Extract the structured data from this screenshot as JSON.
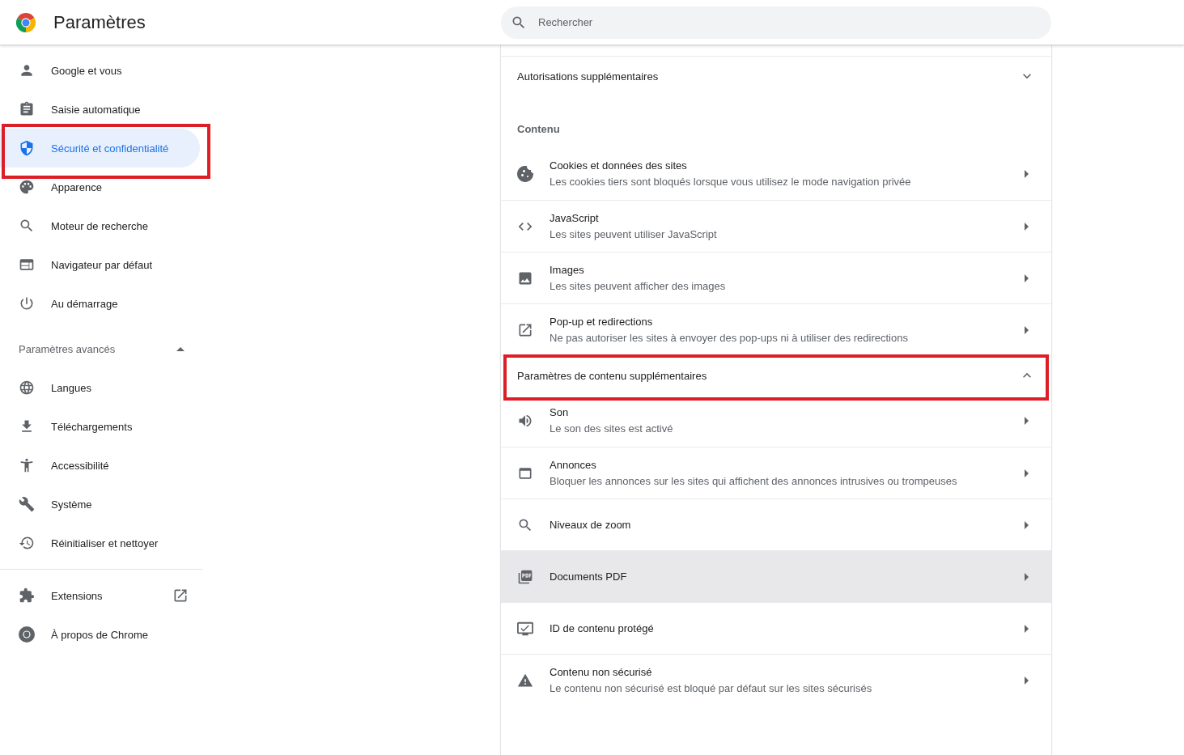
{
  "header": {
    "title": "Paramètres",
    "search": {
      "placeholder": "Rechercher"
    }
  },
  "sidebar": {
    "items": [
      {
        "label": "Google et vous",
        "selected": false,
        "highlighted": false
      },
      {
        "label": "Saisie automatique",
        "selected": false,
        "highlighted": false
      },
      {
        "label": "Sécurité et confidentialité",
        "selected": true,
        "highlighted": true
      },
      {
        "label": "Apparence",
        "selected": false,
        "highlighted": false
      },
      {
        "label": "Moteur de recherche",
        "selected": false,
        "highlighted": false
      },
      {
        "label": "Navigateur par défaut",
        "selected": false,
        "highlighted": false
      },
      {
        "label": "Au démarrage",
        "selected": false,
        "highlighted": false
      }
    ],
    "advanced": {
      "label": "Paramètres avancés",
      "expanded": true,
      "items": [
        {
          "label": "Langues",
          "selected": false
        },
        {
          "label": "Téléchargements",
          "selected": false
        },
        {
          "label": "Accessibilité",
          "selected": false
        },
        {
          "label": "Système",
          "selected": false
        },
        {
          "label": "Réinitialiser et nettoyer",
          "selected": false
        }
      ]
    },
    "links": [
      {
        "label": "Extensions",
        "selected": false,
        "external": true
      },
      {
        "label": "À propos de Chrome",
        "selected": false,
        "external": false
      }
    ]
  },
  "content": {
    "permissions": {
      "label": "Autorisations supplémentaires",
      "expanded": false
    },
    "heading": "Contenu",
    "rows": [
      {
        "title": "Cookies et données des sites",
        "description": "Les cookies tiers sont bloqués lorsque vous utilisez le mode navigation privée",
        "hovered": false
      },
      {
        "title": "JavaScript",
        "description": "Les sites peuvent utiliser JavaScript",
        "hovered": false
      },
      {
        "title": "Images",
        "description": "Les sites peuvent afficher des images",
        "hovered": false
      },
      {
        "title": "Pop-up et redirections",
        "description": "Ne pas autoriser les sites à envoyer des pop-ups ni à utiliser des redirections",
        "hovered": false
      }
    ],
    "more": {
      "label": "Paramètres de contenu supplémentaires",
      "expanded": true,
      "highlighted": true,
      "rows": [
        {
          "title": "Son",
          "description": "Le son des sites est activé",
          "hovered": false
        },
        {
          "title": "Annonces",
          "description": "Bloquer les annonces sur les sites qui affichent des annonces intrusives ou trompeuses",
          "hovered": false
        },
        {
          "title": "Niveaux de zoom",
          "hovered": false
        },
        {
          "title": "Documents PDF",
          "hovered": true
        },
        {
          "title": "ID de contenu protégé",
          "hovered": false
        },
        {
          "title": "Contenu non sécurisé",
          "description": "Le contenu non sécurisé est bloqué par défaut sur les sites sécurisés",
          "hovered": false
        }
      ]
    }
  }
}
